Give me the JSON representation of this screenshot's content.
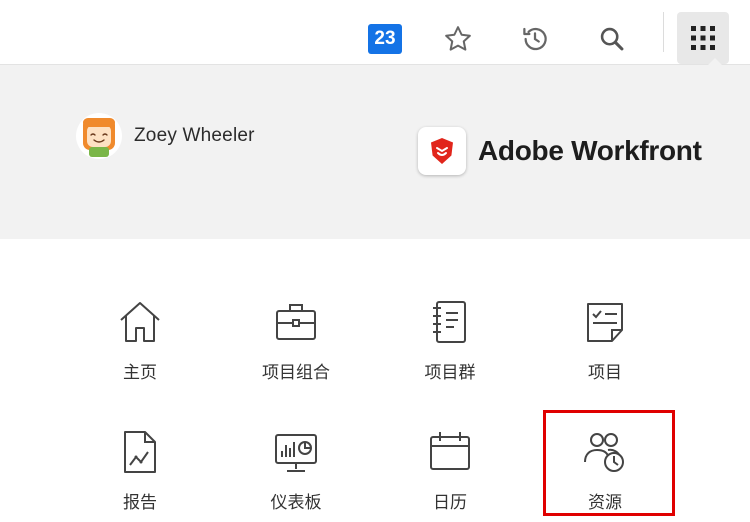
{
  "toolbar": {
    "notification_count": "23",
    "icons": [
      "notification-badge",
      "star-icon",
      "history-icon",
      "search-icon",
      "app-launcher-icon"
    ]
  },
  "user": {
    "name": "Zoey Wheeler"
  },
  "brand": {
    "name": "Adobe Workfront",
    "logo_color": "#e1251b"
  },
  "apps": [
    {
      "label": "主页",
      "icon": "home-icon"
    },
    {
      "label": "项目组合",
      "icon": "portfolio-icon"
    },
    {
      "label": "项目群",
      "icon": "program-icon"
    },
    {
      "label": "项目",
      "icon": "project-icon"
    },
    {
      "label": "报告",
      "icon": "report-icon"
    },
    {
      "label": "仪表板",
      "icon": "dashboard-icon"
    },
    {
      "label": "日历",
      "icon": "calendar-icon"
    },
    {
      "label": "资源",
      "icon": "resources-icon",
      "highlighted": true
    }
  ],
  "colors": {
    "accent_badge": "#1473e6",
    "highlight_border": "#e00000",
    "panel_bg": "#f2f2f2"
  }
}
